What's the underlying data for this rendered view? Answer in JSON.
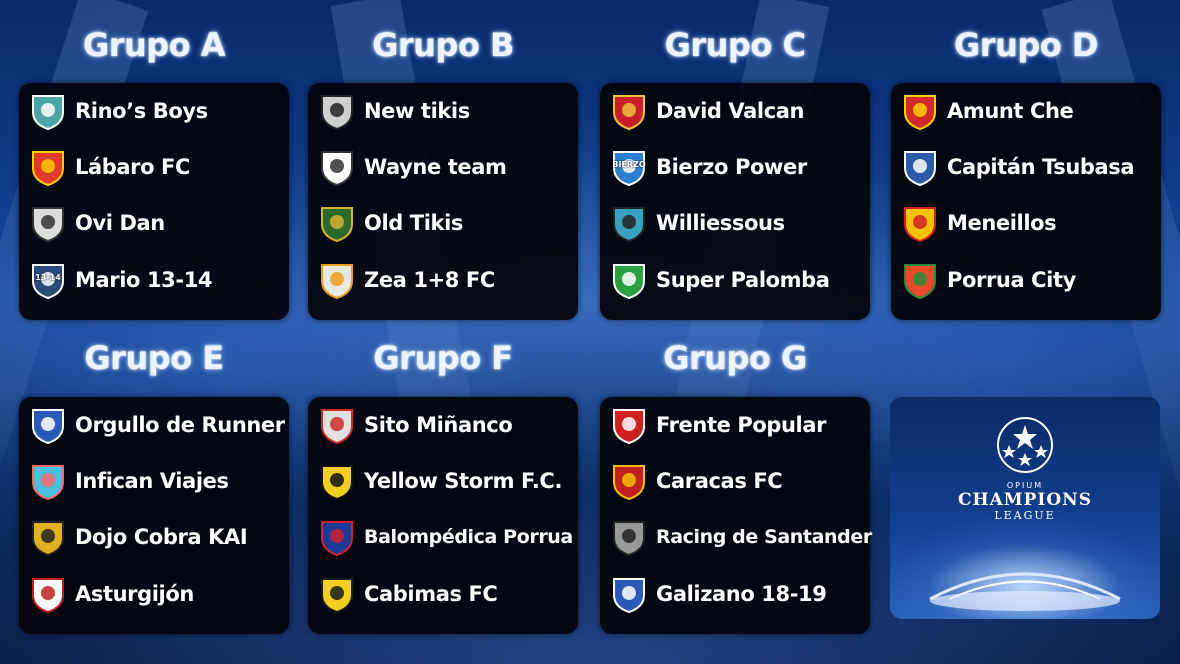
{
  "groups": [
    {
      "title": "Grupo A",
      "teams": [
        {
          "name": "Rino’s Boys",
          "icon": "rhino-crest-icon"
        },
        {
          "name": "Lábaro FC",
          "icon": "labaro-crest-icon"
        },
        {
          "name": "Ovi Dan",
          "icon": "ovi-dan-crest-icon"
        },
        {
          "name": "Mario 13-14",
          "icon": "mario-crest-icon",
          "logo_text": "13-14"
        }
      ]
    },
    {
      "title": "Grupo B",
      "teams": [
        {
          "name": "New tikis",
          "icon": "new-tikis-crest-icon"
        },
        {
          "name": "Wayne team",
          "icon": "wayne-shield-icon"
        },
        {
          "name": "Old Tikis",
          "icon": "tiki-mask-icon"
        },
        {
          "name": "Zea 1+8 FC",
          "icon": "duck-mask-icon"
        }
      ]
    },
    {
      "title": "Grupo C",
      "teams": [
        {
          "name": "David Valcan",
          "icon": "david-valcan-crest-icon"
        },
        {
          "name": "Bierzo Power",
          "icon": "bierzo-crest-icon",
          "logo_text": "BIERZO"
        },
        {
          "name": "Williessous",
          "icon": "wolf-crest-icon"
        },
        {
          "name": "Super Palomba",
          "icon": "pirate-flag-icon"
        }
      ]
    },
    {
      "title": "Grupo D",
      "teams": [
        {
          "name": "Amunt Che",
          "icon": "amunt-che-crest-icon"
        },
        {
          "name": "Capitán Tsubasa",
          "icon": "tsubasa-crest-icon"
        },
        {
          "name": "Meneillos",
          "icon": "smiley-crest-icon"
        },
        {
          "name": "Porrua City",
          "icon": "porrua-city-crest-icon"
        }
      ]
    },
    {
      "title": "Grupo E",
      "teams": [
        {
          "name": "Orgullo de Runner",
          "icon": "runner-crest-icon"
        },
        {
          "name": "Infican Viajes",
          "icon": "infican-logo-icon"
        },
        {
          "name": "Dojo Cobra KAI",
          "icon": "cobra-kai-icon"
        },
        {
          "name": "Asturgijón",
          "icon": "asturgijon-logo-icon"
        }
      ]
    },
    {
      "title": "Grupo F",
      "teams": [
        {
          "name": "Sito Miñanco",
          "icon": "sito-minanco-crest-icon"
        },
        {
          "name": "Yellow Storm F.C.",
          "icon": "yellow-storm-crest-icon"
        },
        {
          "name": "Balompédica Porrua",
          "icon": "balompedica-crest-icon"
        },
        {
          "name": "Cabimas FC",
          "icon": "cabimas-crest-icon"
        }
      ]
    },
    {
      "title": "Grupo G",
      "teams": [
        {
          "name": "Frente Popular",
          "icon": "frente-popular-crest-icon"
        },
        {
          "name": "Caracas FC",
          "icon": "caracas-crest-icon"
        },
        {
          "name": "Racing de Santander",
          "icon": "racing-crest-icon"
        },
        {
          "name": "Galizano 18-19",
          "icon": "galizano-crest-icon"
        }
      ]
    }
  ],
  "logo": {
    "line1": "OPIUM",
    "line2": "CHAMPIONS",
    "line3": "LEAGUE",
    "icon": "starball-icon"
  },
  "colors": {
    "panel": "#03040a",
    "title_glow": "#a0c8ff",
    "background": "#0d3a86"
  }
}
